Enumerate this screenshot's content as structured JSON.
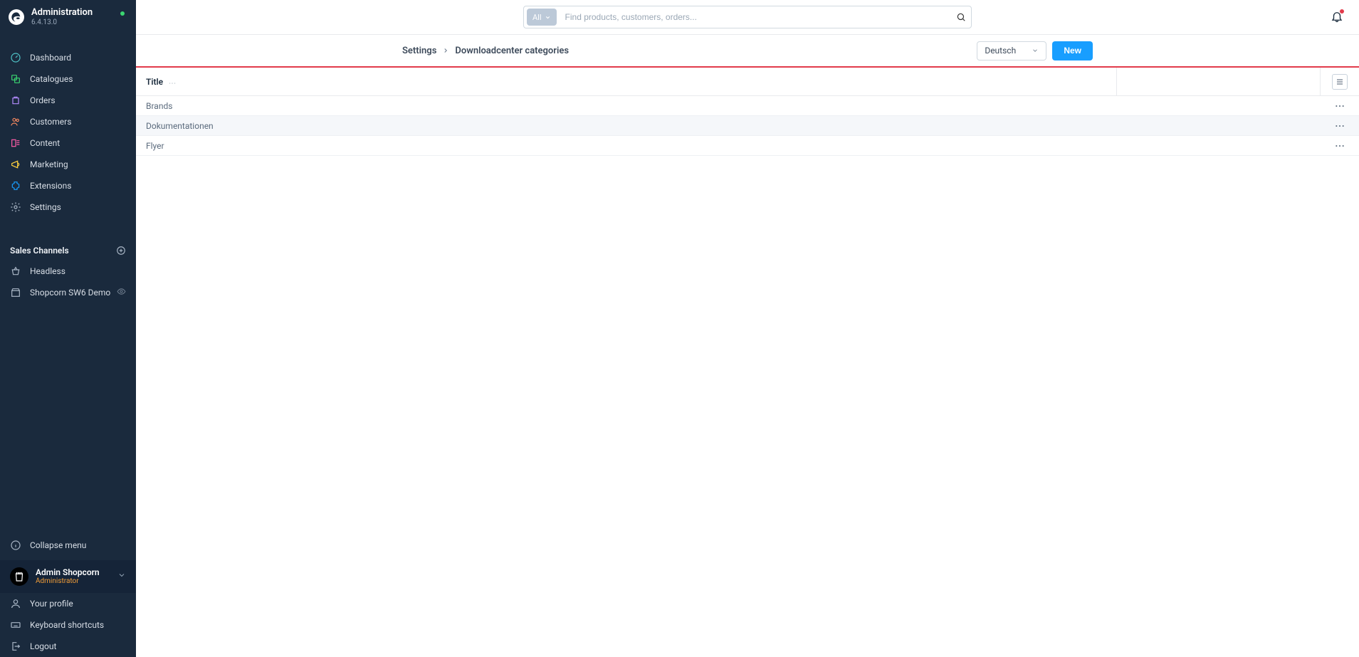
{
  "app": {
    "title": "Administration",
    "version": "6.4.13.0"
  },
  "nav": {
    "items": [
      {
        "icon": "gauge",
        "label": "Dashboard"
      },
      {
        "icon": "catalogues",
        "label": "Catalogues"
      },
      {
        "icon": "orders",
        "label": "Orders"
      },
      {
        "icon": "customers",
        "label": "Customers"
      },
      {
        "icon": "content",
        "label": "Content"
      },
      {
        "icon": "marketing",
        "label": "Marketing"
      },
      {
        "icon": "extensions",
        "label": "Extensions"
      },
      {
        "icon": "settings",
        "label": "Settings"
      }
    ]
  },
  "channels": {
    "header": "Sales Channels",
    "items": [
      {
        "icon": "basket",
        "label": "Headless",
        "eye": false
      },
      {
        "icon": "storefront",
        "label": "Shopcorn SW6 Demo",
        "eye": true
      }
    ]
  },
  "footer": {
    "collapse": "Collapse menu",
    "user_name": "Admin Shopcorn",
    "user_role": "Administrator",
    "items": [
      {
        "icon": "profile",
        "label": "Your profile"
      },
      {
        "icon": "keyboard",
        "label": "Keyboard shortcuts"
      },
      {
        "icon": "logout",
        "label": "Logout"
      }
    ]
  },
  "search": {
    "type_label": "All",
    "placeholder": "Find products, customers, orders..."
  },
  "breadcrumb": {
    "root": "Settings",
    "current": "Downloadcenter categories"
  },
  "toolbar": {
    "language": "Deutsch",
    "new_label": "New"
  },
  "grid": {
    "column_title": "Title",
    "rows": [
      {
        "title": "Brands"
      },
      {
        "title": "Dokumentationen"
      },
      {
        "title": "Flyer"
      }
    ]
  }
}
